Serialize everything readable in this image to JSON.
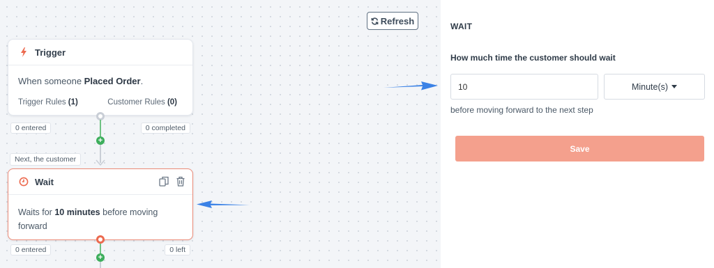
{
  "toolbar": {
    "refresh_label": "Refresh"
  },
  "trigger_node": {
    "title": "Trigger",
    "when_prefix": "When someone ",
    "when_event": "Placed Order",
    "when_suffix": ".",
    "trigger_rules_label": "Trigger Rules ",
    "trigger_rules_count": "(1)",
    "customer_rules_label": "Customer Rules ",
    "customer_rules_count": "(0)",
    "entered": "0 entered",
    "completed": "0 completed"
  },
  "next_label": "Next, the customer",
  "wait_node": {
    "title": "Wait",
    "desc_prefix": "Waits for ",
    "desc_amount": "10 minutes",
    "desc_suffix": " before moving forward",
    "entered": "0 entered",
    "left": "0 left"
  },
  "panel": {
    "title": "WAIT",
    "question": "How much time the customer should wait",
    "time_value": "10",
    "unit": "Minute(s)",
    "hint": "before moving forward to the next step",
    "save_label": "Save"
  },
  "colors": {
    "accent": "#ec6a4f",
    "save": "#f4a08d",
    "plus": "#3dae5c",
    "arrow": "#3b82e6"
  }
}
